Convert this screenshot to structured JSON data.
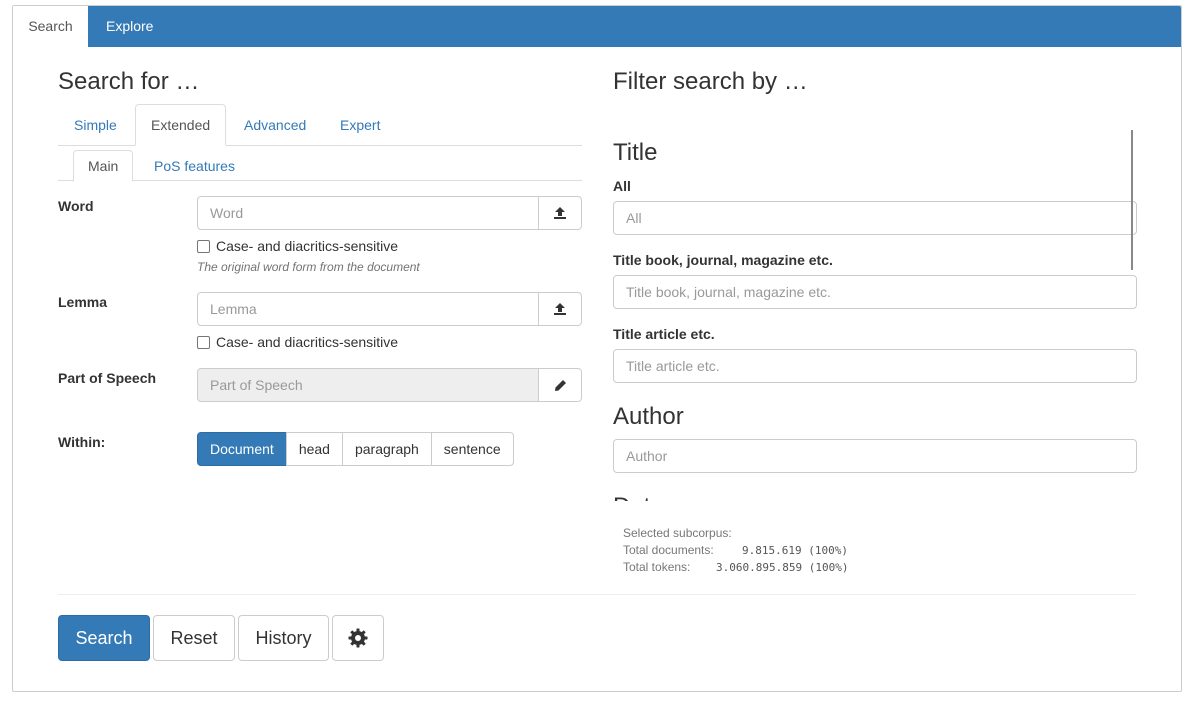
{
  "top_tabs": [
    "Search",
    "Explore"
  ],
  "left": {
    "title": "Search for …",
    "tabs": [
      "Simple",
      "Extended",
      "Advanced",
      "Expert"
    ],
    "subtabs": [
      "Main",
      "PoS features"
    ],
    "word": {
      "label": "Word",
      "placeholder": "Word",
      "checkbox": "Case- and diacritics-sensitive",
      "help": "The original word form from the document"
    },
    "lemma": {
      "label": "Lemma",
      "placeholder": "Lemma",
      "checkbox": "Case- and diacritics-sensitive"
    },
    "pos": {
      "label": "Part of Speech",
      "placeholder": "Part of Speech"
    },
    "within": {
      "label": "Within:",
      "options": [
        "Document",
        "head",
        "paragraph",
        "sentence"
      ],
      "selected": "Document"
    }
  },
  "right": {
    "title": "Filter search by …",
    "title_group": {
      "heading": "Title",
      "all_label": "All",
      "all_placeholder": "All",
      "book_label": "Title book, journal, magazine etc.",
      "book_placeholder": "Title book, journal, magazine etc.",
      "article_label": "Title article etc.",
      "article_placeholder": "Title article etc."
    },
    "author_group": {
      "heading": "Author",
      "placeholder": "Author"
    },
    "date_heading": "Date"
  },
  "subcorpus": {
    "heading": "Selected subcorpus:",
    "documents_label": "Total documents:",
    "documents_value": "9.815.619 (100%)",
    "tokens_label": "Total tokens:",
    "tokens_value": "3.060.895.859 (100%)"
  },
  "actions": {
    "search": "Search",
    "reset": "Reset",
    "history": "History"
  },
  "icons": {
    "upload": "upload-icon",
    "pencil": "pencil-icon",
    "settings": "gear-icon"
  },
  "colors": {
    "primary": "#337ab7",
    "border": "#cccccc"
  }
}
